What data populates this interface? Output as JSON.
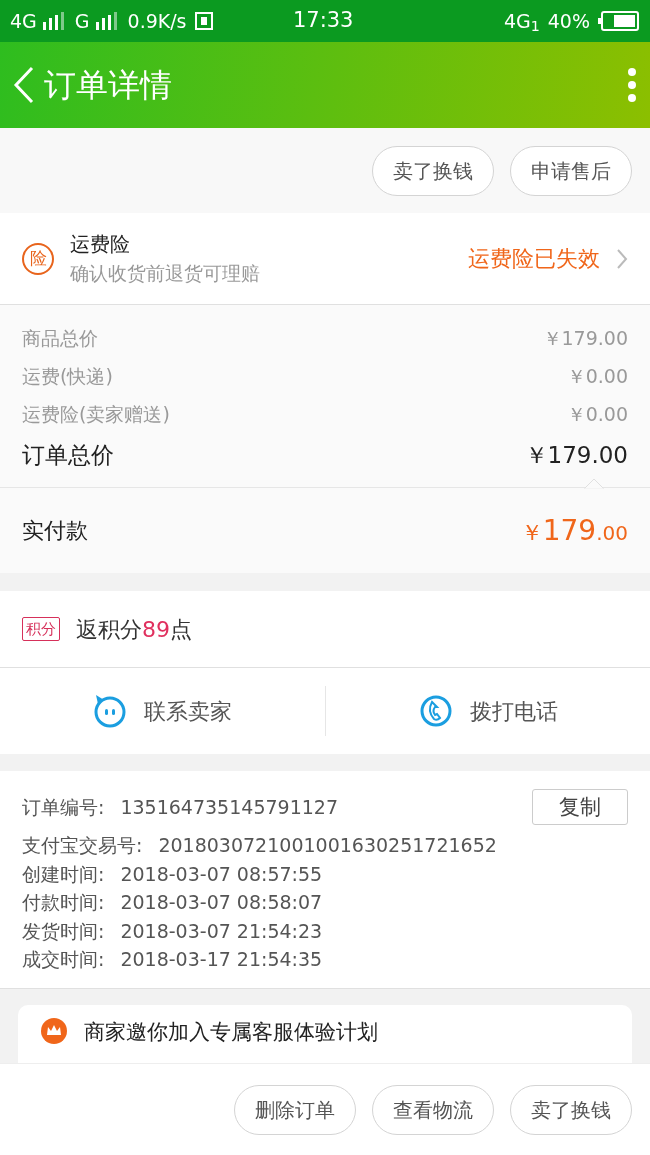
{
  "status_bar": {
    "left": [
      "4G",
      "G"
    ],
    "speed": "0.9K/s",
    "time": "17:33",
    "network": "4G$_{1}$",
    "battery": "40%"
  },
  "header": {
    "title": "订单详情"
  },
  "top_actions": [
    "卖了换钱",
    "申请售后"
  ],
  "insurance": {
    "badge": "险",
    "title": "运费险",
    "subtitle": "确认收货前退货可理赔",
    "status": "运费险已失效"
  },
  "price_rows": [
    {
      "kind": "minor",
      "label": "商品总价",
      "value": "￥179.00"
    },
    {
      "kind": "minor",
      "label": "运费(快递)",
      "value": "￥0.00"
    },
    {
      "kind": "minor",
      "label": "运费险(卖家赠送)",
      "value": "￥0.00"
    },
    {
      "kind": "total",
      "label": "订单总价",
      "value": "￥179.00"
    }
  ],
  "paid": {
    "label": "实付款",
    "currency": "￥",
    "integer": "179",
    "decimal": ".00"
  },
  "points": {
    "badge": "积分",
    "prefix": "返积分",
    "number": "89",
    "suffix": "点"
  },
  "contact": [
    {
      "kind": "chat",
      "label": "联系卖家"
    },
    {
      "kind": "phone",
      "label": "拨打电话"
    }
  ],
  "order_info": [
    {
      "label": "订单编号:",
      "value": "135164735145791127",
      "copy": "复制"
    },
    {
      "label": "支付宝交易号:",
      "value": "2018030721001001630251721652"
    },
    {
      "label": "创建时间:",
      "value": "2018-03-07 08:57:55"
    },
    {
      "label": "付款时间:",
      "value": "2018-03-07 08:58:07"
    },
    {
      "label": "发货时间:",
      "value": "2018-03-07 21:54:23"
    },
    {
      "label": "成交时间:",
      "value": "2018-03-17 21:54:35"
    }
  ],
  "banner": {
    "text": "商家邀你加入专属客服体验计划"
  },
  "bottom_actions": [
    "删除订单",
    "查看物流",
    "卖了换钱"
  ]
}
